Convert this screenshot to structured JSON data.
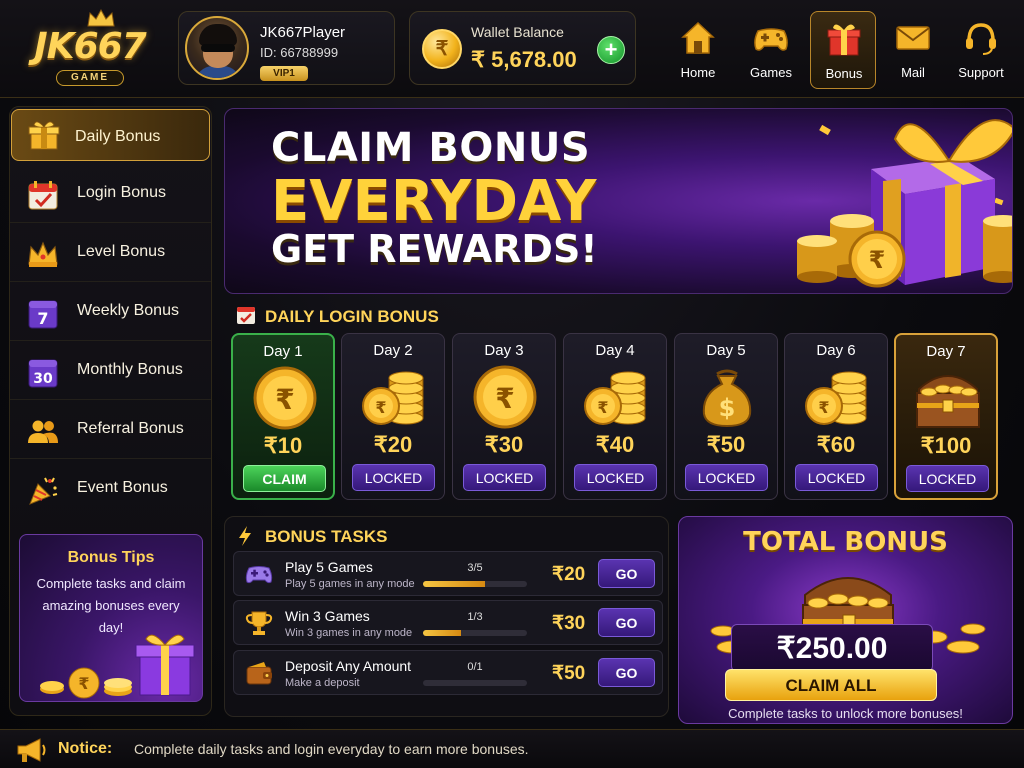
{
  "brand": {
    "name": "JK667",
    "sub": "GAME"
  },
  "profile": {
    "name": "JK667Player",
    "id": "ID: 66788999",
    "vip": "VIP1"
  },
  "wallet": {
    "label": "Wallet Balance",
    "amount": "₹ 5,678.00",
    "coin_symbol": "₹"
  },
  "nav": [
    {
      "label": "Home",
      "icon": "home-icon"
    },
    {
      "label": "Games",
      "icon": "gamepad-icon"
    },
    {
      "label": "Bonus",
      "icon": "gift-icon",
      "active": true
    },
    {
      "label": "Mail",
      "icon": "mail-icon"
    },
    {
      "label": "Support",
      "icon": "headset-icon"
    }
  ],
  "sidebar": {
    "items": [
      {
        "label": "Daily Bonus",
        "icon": "gift-icon",
        "active": true
      },
      {
        "label": "Login Bonus",
        "icon": "calendar-check-icon"
      },
      {
        "label": "Level Bonus",
        "icon": "crown-icon"
      },
      {
        "label": "Weekly Bonus",
        "icon": "calendar-7-icon",
        "num": "7"
      },
      {
        "label": "Monthly Bonus",
        "icon": "calendar-30-icon",
        "num": "30"
      },
      {
        "label": "Referral Bonus",
        "icon": "users-icon"
      },
      {
        "label": "Event Bonus",
        "icon": "party-popper-icon"
      }
    ],
    "tips": {
      "title": "Bonus Tips",
      "text": "Complete tasks and claim amazing bonuses every day!"
    }
  },
  "banner": {
    "line1": "CLAIM BONUS",
    "line2": "EVERYDAY",
    "line3": "GET REWARDS!"
  },
  "daily": {
    "title": "DAILY LOGIN BONUS",
    "days": [
      {
        "label": "Day 1",
        "amount": "₹10",
        "button": "CLAIM",
        "state": "claim",
        "art": "coin"
      },
      {
        "label": "Day 2",
        "amount": "₹20",
        "button": "LOCKED",
        "state": "locked",
        "art": "coin-stack"
      },
      {
        "label": "Day 3",
        "amount": "₹30",
        "button": "LOCKED",
        "state": "locked",
        "art": "coin"
      },
      {
        "label": "Day 4",
        "amount": "₹40",
        "button": "LOCKED",
        "state": "locked",
        "art": "coin-stack"
      },
      {
        "label": "Day 5",
        "amount": "₹50",
        "button": "LOCKED",
        "state": "locked",
        "art": "money-bag"
      },
      {
        "label": "Day 6",
        "amount": "₹60",
        "button": "LOCKED",
        "state": "locked",
        "art": "coin-stack"
      },
      {
        "label": "Day 7",
        "amount": "₹100",
        "button": "LOCKED",
        "state": "special",
        "art": "treasure-chest"
      }
    ]
  },
  "tasks": {
    "title": "BONUS TASKS",
    "items": [
      {
        "title": "Play 5 Games",
        "sub": "Play 5 games in any mode",
        "progress": "3/5",
        "fraction": 0.6,
        "reward": "₹20",
        "go": "GO",
        "icon": "gamepad-icon"
      },
      {
        "title": "Win 3 Games",
        "sub": "Win 3 games in any mode",
        "progress": "1/3",
        "fraction": 0.37,
        "reward": "₹30",
        "go": "GO",
        "icon": "trophy-icon"
      },
      {
        "title": "Deposit Any Amount",
        "sub": "Make a deposit",
        "progress": "0/1",
        "fraction": 0,
        "reward": "₹50",
        "go": "GO",
        "icon": "wallet-icon"
      }
    ]
  },
  "total": {
    "title": "TOTAL BONUS",
    "amount": "₹250.00",
    "button": "CLAIM ALL",
    "note": "Complete tasks to unlock more bonuses!"
  },
  "notice": {
    "label": "Notice:",
    "text": "Complete daily tasks and login everyday to earn more bonuses."
  },
  "colors": {
    "gold": "#ffd45a",
    "purple": "#5a34b0",
    "green": "#2aa83a",
    "bg": "#0b0b0f"
  }
}
